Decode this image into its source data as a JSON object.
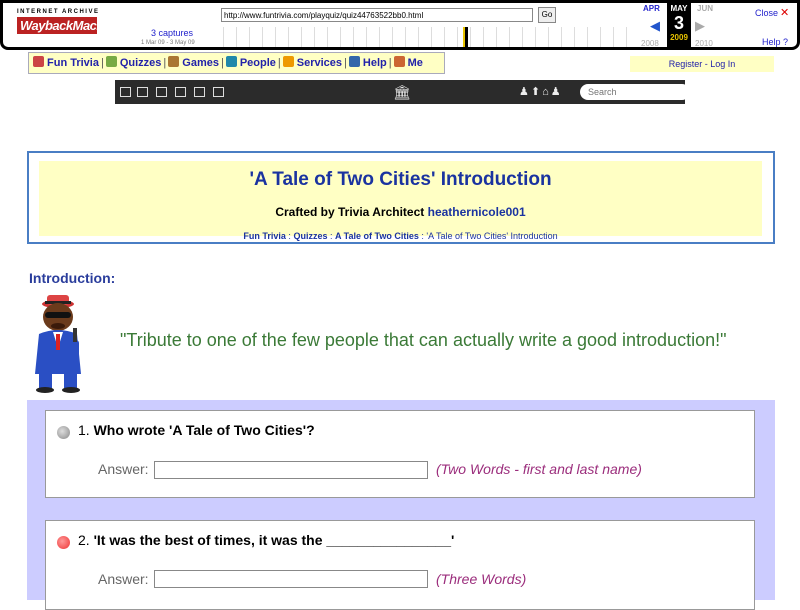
{
  "wayback": {
    "logo_top": "INTERNET ARCHIVE",
    "logo_bottom": "WaybackMachine",
    "url": "http://www.funtrivia.com/playquiz/quiz44763522bb0.html",
    "go_label": "Go",
    "captures": "3 captures",
    "date_range": "1 Mar 09 - 3 May 09",
    "prev_month": "APR",
    "cur_month": "MAY",
    "next_month": "JUN",
    "cur_day": "3",
    "prev_year": "2008",
    "cur_year": "2009",
    "next_year": "2010",
    "close_label": "Close",
    "help_label": "Help",
    "prev_arrow": "◀",
    "next_arrow": "▶",
    "close_icon": "✕",
    "help_icon": "?"
  },
  "nav": {
    "items": [
      {
        "label": "Fun Trivia",
        "icon": "house-icon",
        "color": "#c44"
      },
      {
        "label": "Quizzes",
        "icon": "quiz-icon",
        "color": "#7a4"
      },
      {
        "label": "Games",
        "icon": "games-icon",
        "color": "#a73"
      },
      {
        "label": "People",
        "icon": "globe-icon",
        "color": "#28a"
      },
      {
        "label": "Services",
        "icon": "star-icon",
        "color": "#e90"
      },
      {
        "label": "Help",
        "icon": "info-icon",
        "color": "#36a"
      },
      {
        "label": "Me",
        "icon": "me-icon",
        "color": "#c63"
      }
    ],
    "separator": "|",
    "register": "Register - Log In"
  },
  "darkbar": {
    "search_placeholder": "Search",
    "home_glyph": "🏛",
    "users_glyph": "♟⬆⌂♟",
    "menu_glyph": "☰"
  },
  "header": {
    "title": "'A Tale of Two Cities' Introduction",
    "crafted_prefix": "Crafted by Trivia Architect",
    "author": "heathernicole001",
    "crumb_1": "Fun Trivia",
    "crumb_2": "Quizzes",
    "crumb_3": "A Tale of Two Cities",
    "crumb_4": "'A Tale of Two Cities' Introduction",
    "crumb_sep": ":"
  },
  "intro": {
    "label": "Introduction:",
    "quote": "\"Tribute to one of the few people that can actually write a good introduction!\""
  },
  "questions": [
    {
      "number": "1.",
      "text": "Who wrote 'A Tale of Two Cities'?",
      "answer_label": "Answer:",
      "hint": "(Two Words - first and last name)",
      "radio_color": "#888"
    },
    {
      "number": "2.",
      "text": "'It was the best of times, it was the ________________'",
      "answer_label": "Answer:",
      "hint": "(Three Words)",
      "radio_color": "#e33"
    }
  ]
}
